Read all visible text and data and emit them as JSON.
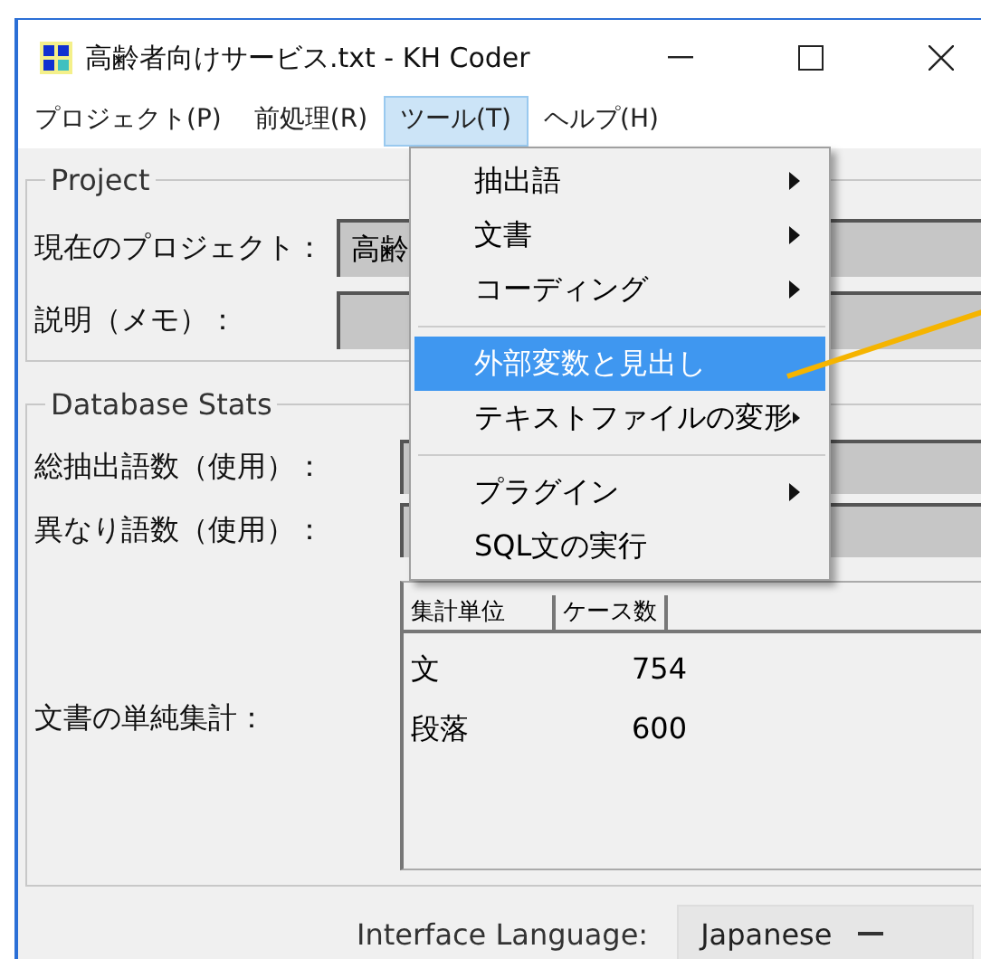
{
  "window": {
    "title": "高齢者向けサービス.txt - KH Coder"
  },
  "menu_bar": [
    {
      "label": "プロジェクト(P)",
      "selected": false
    },
    {
      "label": "前処理(R)",
      "selected": false
    },
    {
      "label": "ツール(T)",
      "selected": true
    },
    {
      "label": "ヘルプ(H)",
      "selected": false
    }
  ],
  "project": {
    "legend": "Project",
    "fields": [
      {
        "label": "現在のプロジェクト：",
        "value": "高齢"
      },
      {
        "label": "説明（メモ）："
      }
    ]
  },
  "database_stats": {
    "legend": "Database Stats",
    "fields": [
      {
        "label": "総抽出語数（使用）："
      },
      {
        "label": "異なり語数（使用）："
      }
    ],
    "table_label": "文書の単純集計：",
    "table": {
      "columns": [
        "集計単位",
        "ケース数"
      ],
      "rows": [
        [
          "文",
          "754"
        ],
        [
          "段落",
          "600"
        ]
      ]
    }
  },
  "interface_language": {
    "label": "Interface Language:",
    "value": "Japanese"
  },
  "dropdown_menu": [
    {
      "kind": "item",
      "label": "抽出語",
      "submenu": true,
      "selected": false
    },
    {
      "kind": "item",
      "label": "文書",
      "submenu": true,
      "selected": false
    },
    {
      "kind": "item",
      "label": "コーディング",
      "submenu": true,
      "selected": false
    },
    {
      "kind": "separator"
    },
    {
      "kind": "item",
      "label": "外部変数と見出し",
      "submenu": false,
      "selected": true
    },
    {
      "kind": "item",
      "label": "テキストファイルの変形",
      "submenu": true,
      "selected": false
    },
    {
      "kind": "separator"
    },
    {
      "kind": "item",
      "label": "プラグイン",
      "submenu": true,
      "selected": false
    },
    {
      "kind": "item",
      "label": "SQL文の実行",
      "submenu": false,
      "selected": false
    }
  ]
}
